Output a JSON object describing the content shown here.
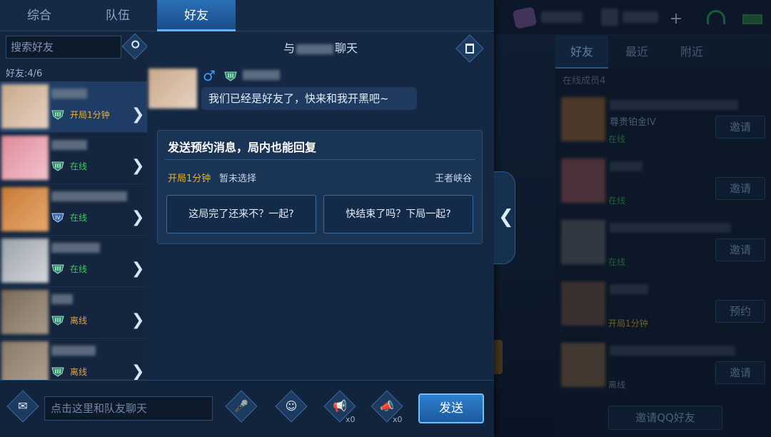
{
  "tabs": [
    {
      "label": "综合"
    },
    {
      "label": "队伍"
    },
    {
      "label": "好友"
    }
  ],
  "active_tab": "好友",
  "search": {
    "placeholder": "搜索好友"
  },
  "friend_count": "好友:4/6",
  "friends": [
    {
      "status": "开局1分钟"
    },
    {
      "status": "在线"
    },
    {
      "status": "在线"
    },
    {
      "status": "在线"
    },
    {
      "status": "离线"
    },
    {
      "status": "离线"
    }
  ],
  "chat": {
    "title_prefix": "与",
    "title_suffix": "聊天",
    "message": "我们已经是好友了，快来和我开黑吧~"
  },
  "card": {
    "title": "发送预约消息，局内也能回复",
    "time": "开局1分钟",
    "selection": "暂未选择",
    "mode": "王者峡谷",
    "option1": "这局完了还来不？一起?",
    "option2": "快结束了吗？下局一起?"
  },
  "bottom": {
    "input_placeholder": "点击这里和队友聊天",
    "horn1_count": "x0",
    "horn2_count": "x0",
    "send_label": "发送"
  },
  "right_panel": {
    "tabs": [
      "好友",
      "最近",
      "附近"
    ],
    "online_count": "在线成员4",
    "items": [
      {
        "rank": "尊贵铂金IV",
        "status": "在线",
        "button": "邀请"
      },
      {
        "rank": "",
        "status": "在线",
        "button": "邀请"
      },
      {
        "rank": "",
        "status": "在线",
        "button": "邀请"
      },
      {
        "rank": "",
        "status": "开局1分钟",
        "button": "预约"
      },
      {
        "rank": "",
        "status": "离线",
        "button": "邀请"
      }
    ],
    "qq_invite": "邀请QQ好友"
  },
  "colors": {
    "accent": "#2a6fb5",
    "online": "#2fd15a",
    "in_game": "#e5b23a",
    "male": "#3b9bff"
  },
  "icons": [
    "search-icon",
    "trash-icon",
    "male-icon",
    "rank-icon",
    "chevron-right-icon",
    "chevron-left-icon",
    "voice-text-icon",
    "microphone-icon",
    "emoji-icon",
    "horn-icon",
    "loudspeaker-icon",
    "qq-icon"
  ]
}
